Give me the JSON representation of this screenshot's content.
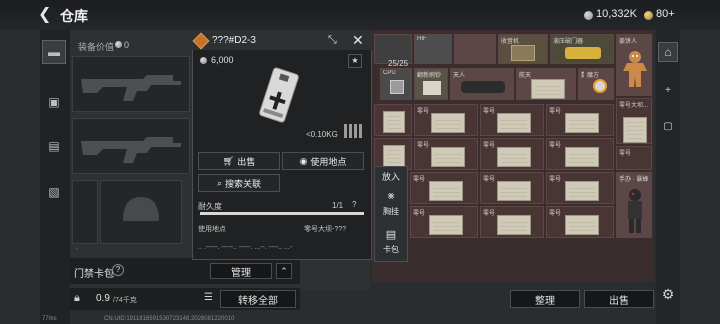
{
  "header": {
    "title": "仓库",
    "currency_silver": "10,332K",
    "currency_gold": "80+"
  },
  "equipment": {
    "label": "装备价值",
    "value": "0"
  },
  "keycard": {
    "label": "门禁卡包",
    "help": "?",
    "manage_label": "管理"
  },
  "capacity": {
    "current": "0.9",
    "max": "/74千克",
    "transfer_all_label": "转移全部"
  },
  "item_popup": {
    "title": "???#D2-3",
    "price": "6,000",
    "weight": "<0.10KG",
    "sell_label": "出售",
    "use_location_label": "使用地点",
    "search_related_label": "搜索关联",
    "durability_label": "耐久度",
    "durability_value": "1/1",
    "durability_help": "?",
    "durability_fraction": 1.0,
    "use_place_label": "使用地点",
    "use_place_value": "零号大坝-???",
    "dots_row": ".. .-----. -----.. -----. ...--. ----.. ...-"
  },
  "context_menu": {
    "put_label": "放入",
    "hang_label": "胸挂",
    "card_label": "卡包"
  },
  "inventory": {
    "count": "25/25",
    "top_labels": [
      "HIF",
      "收音机",
      "液压破门器",
      "姜饼人"
    ],
    "row2_labels": [
      "CPU",
      "翻新刷钞",
      "天人",
      "航天",
      "数",
      "魔方"
    ],
    "side_label": "零号大坝...",
    "paper_label": "零号",
    "special_label": "手办 · 暴蜂",
    "sort_label": "整理",
    "sell_label": "出售"
  },
  "footer": {
    "ping": "77ms",
    "uid": "CN.UID:1911816591530723148.2026081220010"
  }
}
